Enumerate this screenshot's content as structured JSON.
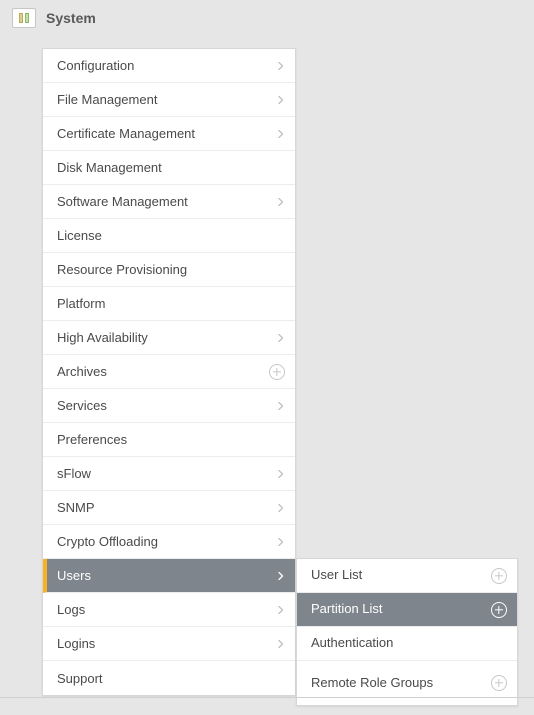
{
  "header": {
    "title": "System"
  },
  "menu": {
    "items": [
      {
        "label": "Configuration",
        "has_submenu": true,
        "has_add": false,
        "selected": false
      },
      {
        "label": "File Management",
        "has_submenu": true,
        "has_add": false,
        "selected": false
      },
      {
        "label": "Certificate Management",
        "has_submenu": true,
        "has_add": false,
        "selected": false
      },
      {
        "label": "Disk Management",
        "has_submenu": false,
        "has_add": false,
        "selected": false
      },
      {
        "label": "Software Management",
        "has_submenu": true,
        "has_add": false,
        "selected": false
      },
      {
        "label": "License",
        "has_submenu": false,
        "has_add": false,
        "selected": false
      },
      {
        "label": "Resource Provisioning",
        "has_submenu": false,
        "has_add": false,
        "selected": false
      },
      {
        "label": "Platform",
        "has_submenu": false,
        "has_add": false,
        "selected": false
      },
      {
        "label": "High Availability",
        "has_submenu": true,
        "has_add": false,
        "selected": false
      },
      {
        "label": "Archives",
        "has_submenu": false,
        "has_add": true,
        "selected": false
      },
      {
        "label": "Services",
        "has_submenu": true,
        "has_add": false,
        "selected": false
      },
      {
        "label": "Preferences",
        "has_submenu": false,
        "has_add": false,
        "selected": false
      },
      {
        "label": "sFlow",
        "has_submenu": true,
        "has_add": false,
        "selected": false
      },
      {
        "label": "SNMP",
        "has_submenu": true,
        "has_add": false,
        "selected": false
      },
      {
        "label": "Crypto Offloading",
        "has_submenu": true,
        "has_add": false,
        "selected": false
      },
      {
        "label": "Users",
        "has_submenu": true,
        "has_add": false,
        "selected": true
      },
      {
        "label": "Logs",
        "has_submenu": true,
        "has_add": false,
        "selected": false
      },
      {
        "label": "Logins",
        "has_submenu": true,
        "has_add": false,
        "selected": false
      },
      {
        "label": "Support",
        "has_submenu": false,
        "has_add": false,
        "selected": false
      }
    ]
  },
  "submenu": {
    "parent": "Users",
    "items": [
      {
        "label": "User List",
        "has_add": true,
        "selected": false
      },
      {
        "label": "Partition List",
        "has_add": true,
        "selected": true
      },
      {
        "label": "Authentication",
        "has_add": false,
        "selected": false
      },
      {
        "label": "Remote Role Groups",
        "has_add": true,
        "selected": false
      }
    ]
  }
}
